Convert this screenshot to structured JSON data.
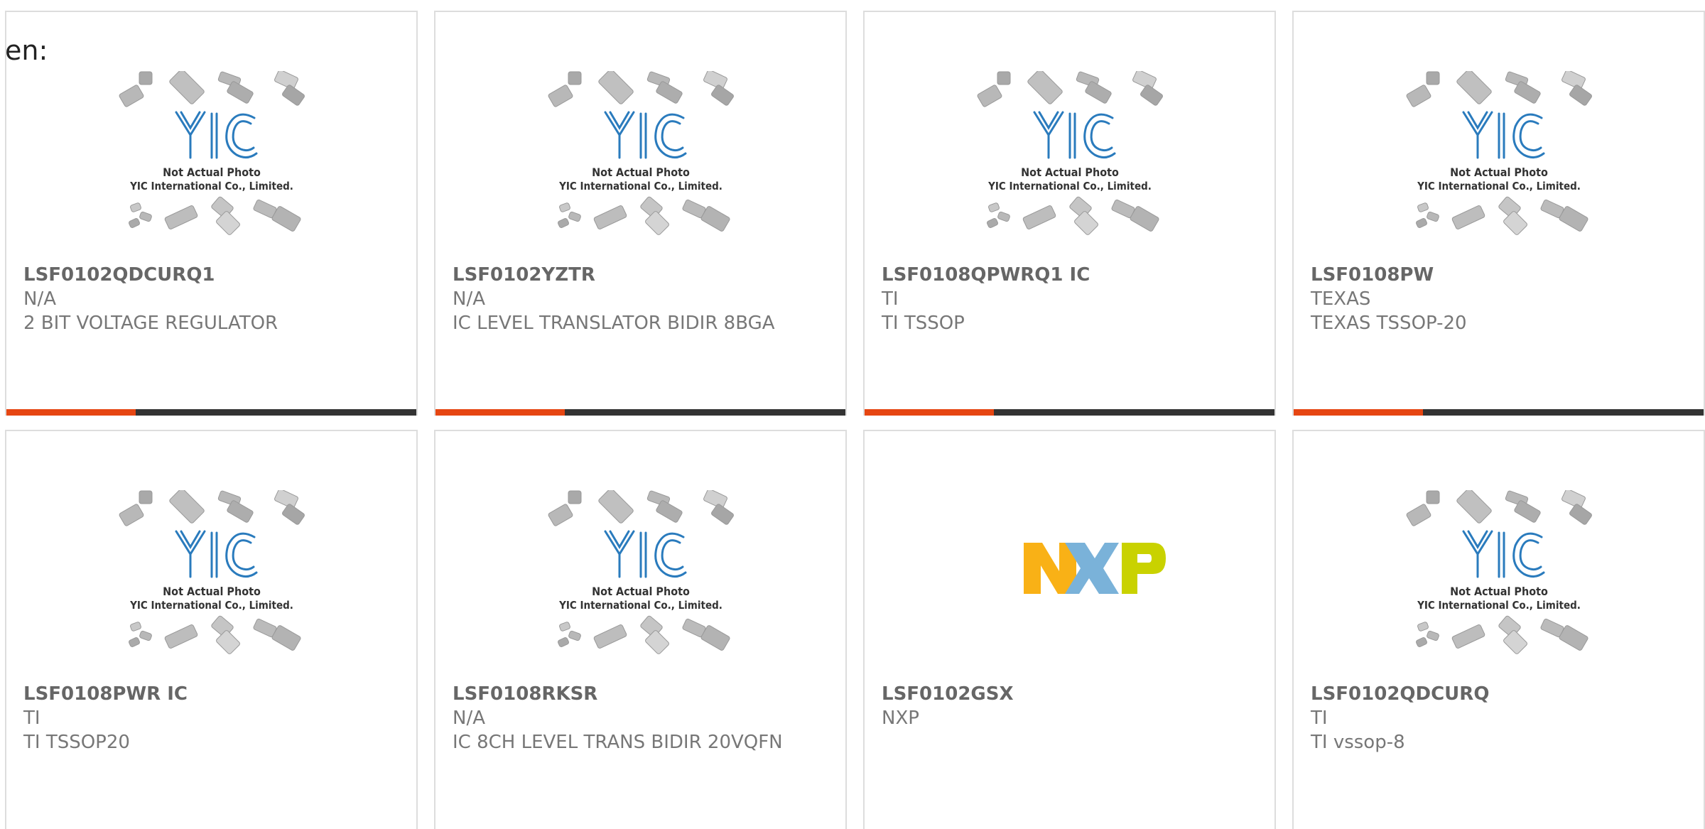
{
  "page": {
    "language_label": "en:"
  },
  "colors": {
    "accent": "#e64612",
    "bar_dark": "#333333",
    "card_border": "#dddddd",
    "yic_blue": "#2a7bbd"
  },
  "placeholder_image": {
    "line1": "Not Actual Photo",
    "line2": "YIC International Co., Limited."
  },
  "products": [
    {
      "part_number": "LSF0102QDCURQ1",
      "manufacturer": "N/A",
      "description": "2 BIT VOLTAGE REGULATOR",
      "image": "yic-placeholder",
      "accent_bar": true
    },
    {
      "part_number": "LSF0102YZTR",
      "manufacturer": "N/A",
      "description": "IC LEVEL TRANSLATOR BIDIR 8BGA",
      "image": "yic-placeholder",
      "accent_bar": true
    },
    {
      "part_number": "LSF0108QPWRQ1 IC",
      "manufacturer": "TI",
      "description": "TI TSSOP",
      "image": "yic-placeholder",
      "accent_bar": true
    },
    {
      "part_number": "LSF0108PW",
      "manufacturer": "TEXAS",
      "description": "TEXAS TSSOP-20",
      "image": "yic-placeholder",
      "accent_bar": true
    },
    {
      "part_number": "LSF0108PWR IC",
      "manufacturer": "TI",
      "description": "TI TSSOP20",
      "image": "yic-placeholder",
      "accent_bar": false
    },
    {
      "part_number": "LSF0108RKSR",
      "manufacturer": "N/A",
      "description": "IC 8CH LEVEL TRANS BIDIR 20VQFN",
      "image": "yic-placeholder",
      "accent_bar": false
    },
    {
      "part_number": "LSF0102GSX",
      "manufacturer": "NXP",
      "description": "",
      "image": "nxp-logo",
      "accent_bar": false
    },
    {
      "part_number": "LSF0102QDCURQ",
      "manufacturer": "TI",
      "description": "TI vssop-8",
      "image": "yic-placeholder",
      "accent_bar": false
    }
  ]
}
